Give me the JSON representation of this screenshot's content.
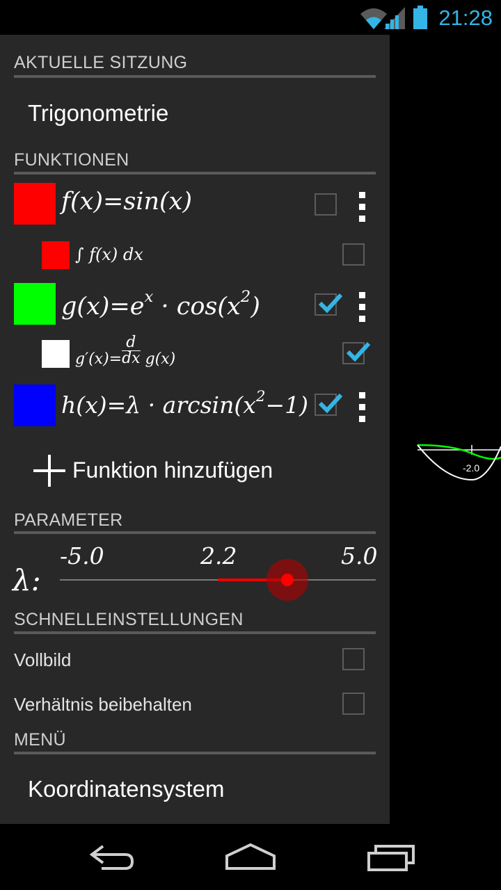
{
  "status_bar": {
    "time": "21:28"
  },
  "drawer": {
    "current_session": {
      "header": "AKTUELLE SITZUNG",
      "name": "Trigonometrie"
    },
    "functions": {
      "header": "FUNKTIONEN",
      "items": [
        {
          "label": "f(x)=sin(x)",
          "color": "#ff0000",
          "checked": false,
          "sub": false
        },
        {
          "label": "∫ f(x) dx",
          "color": "#ff0000",
          "checked": false,
          "sub": true
        },
        {
          "label": "g(x)=e^x · cos(x^2)",
          "color": "#00ff00",
          "checked": true,
          "sub": false
        },
        {
          "label": "g′(x)= d/dx g(x)",
          "color": "#ffffff",
          "checked": true,
          "sub": true
        },
        {
          "label": "h(x)=λ · arcsin(x^2−1)",
          "color": "#0000ff",
          "checked": true,
          "sub": false
        }
      ],
      "add_label": "Funktion hinzufügen"
    },
    "parameter": {
      "header": "PARAMETER",
      "symbol": "λ:",
      "min": "-5.0",
      "value": "2.2",
      "max": "5.0",
      "fraction": 0.72
    },
    "quick_settings": {
      "header": "SCHNELLEINSTELLUNGEN",
      "fullscreen": {
        "label": "Vollbild",
        "checked": false
      },
      "keep_ratio": {
        "label": "Verhältnis beibehalten",
        "checked": false
      }
    },
    "menu": {
      "header": "MENÜ",
      "item": "Koordinatensystem"
    }
  },
  "graph": {
    "tick_label": "-2.0"
  },
  "colors": {
    "accent": "#33b5e5",
    "drawer_bg": "#282828",
    "slider": "#ff0000"
  },
  "icons": [
    "wifi-icon",
    "signal-icon",
    "battery-icon",
    "overflow-menu-icon",
    "checkmark-icon",
    "plus-icon",
    "back-icon",
    "home-icon",
    "recents-icon"
  ]
}
